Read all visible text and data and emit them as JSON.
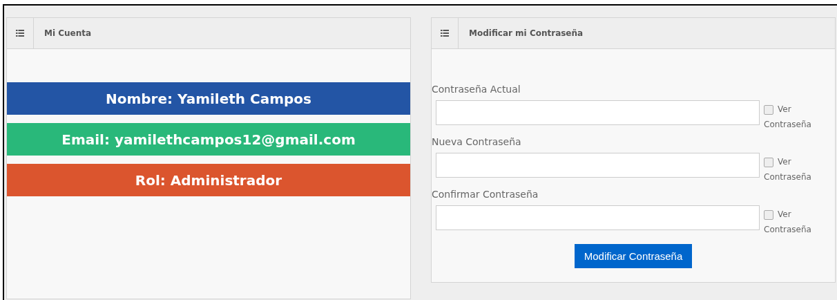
{
  "account_panel": {
    "title": "Mi Cuenta",
    "info_bars": [
      {
        "text": "Nombre: Yamileth Campos",
        "color": "#2355a5"
      },
      {
        "text": "Email: yamilethcampos12@gmail.com",
        "color": "#29b87a"
      },
      {
        "text": "Rol: Administrador",
        "color": "#db552e"
      }
    ]
  },
  "password_panel": {
    "title": "Modificar mi Contraseña",
    "fields": [
      {
        "label": "Contraseña Actual",
        "toggle_label": "Ver Contraseña",
        "checked": false
      },
      {
        "label": "Nueva Contraseña",
        "toggle_label": "Ver Contraseña",
        "checked": false
      },
      {
        "label": "Confirmar Contraseña",
        "toggle_label": "Ver Contraseña",
        "checked": false
      }
    ],
    "submit_button": "Modificar Contraseña"
  }
}
